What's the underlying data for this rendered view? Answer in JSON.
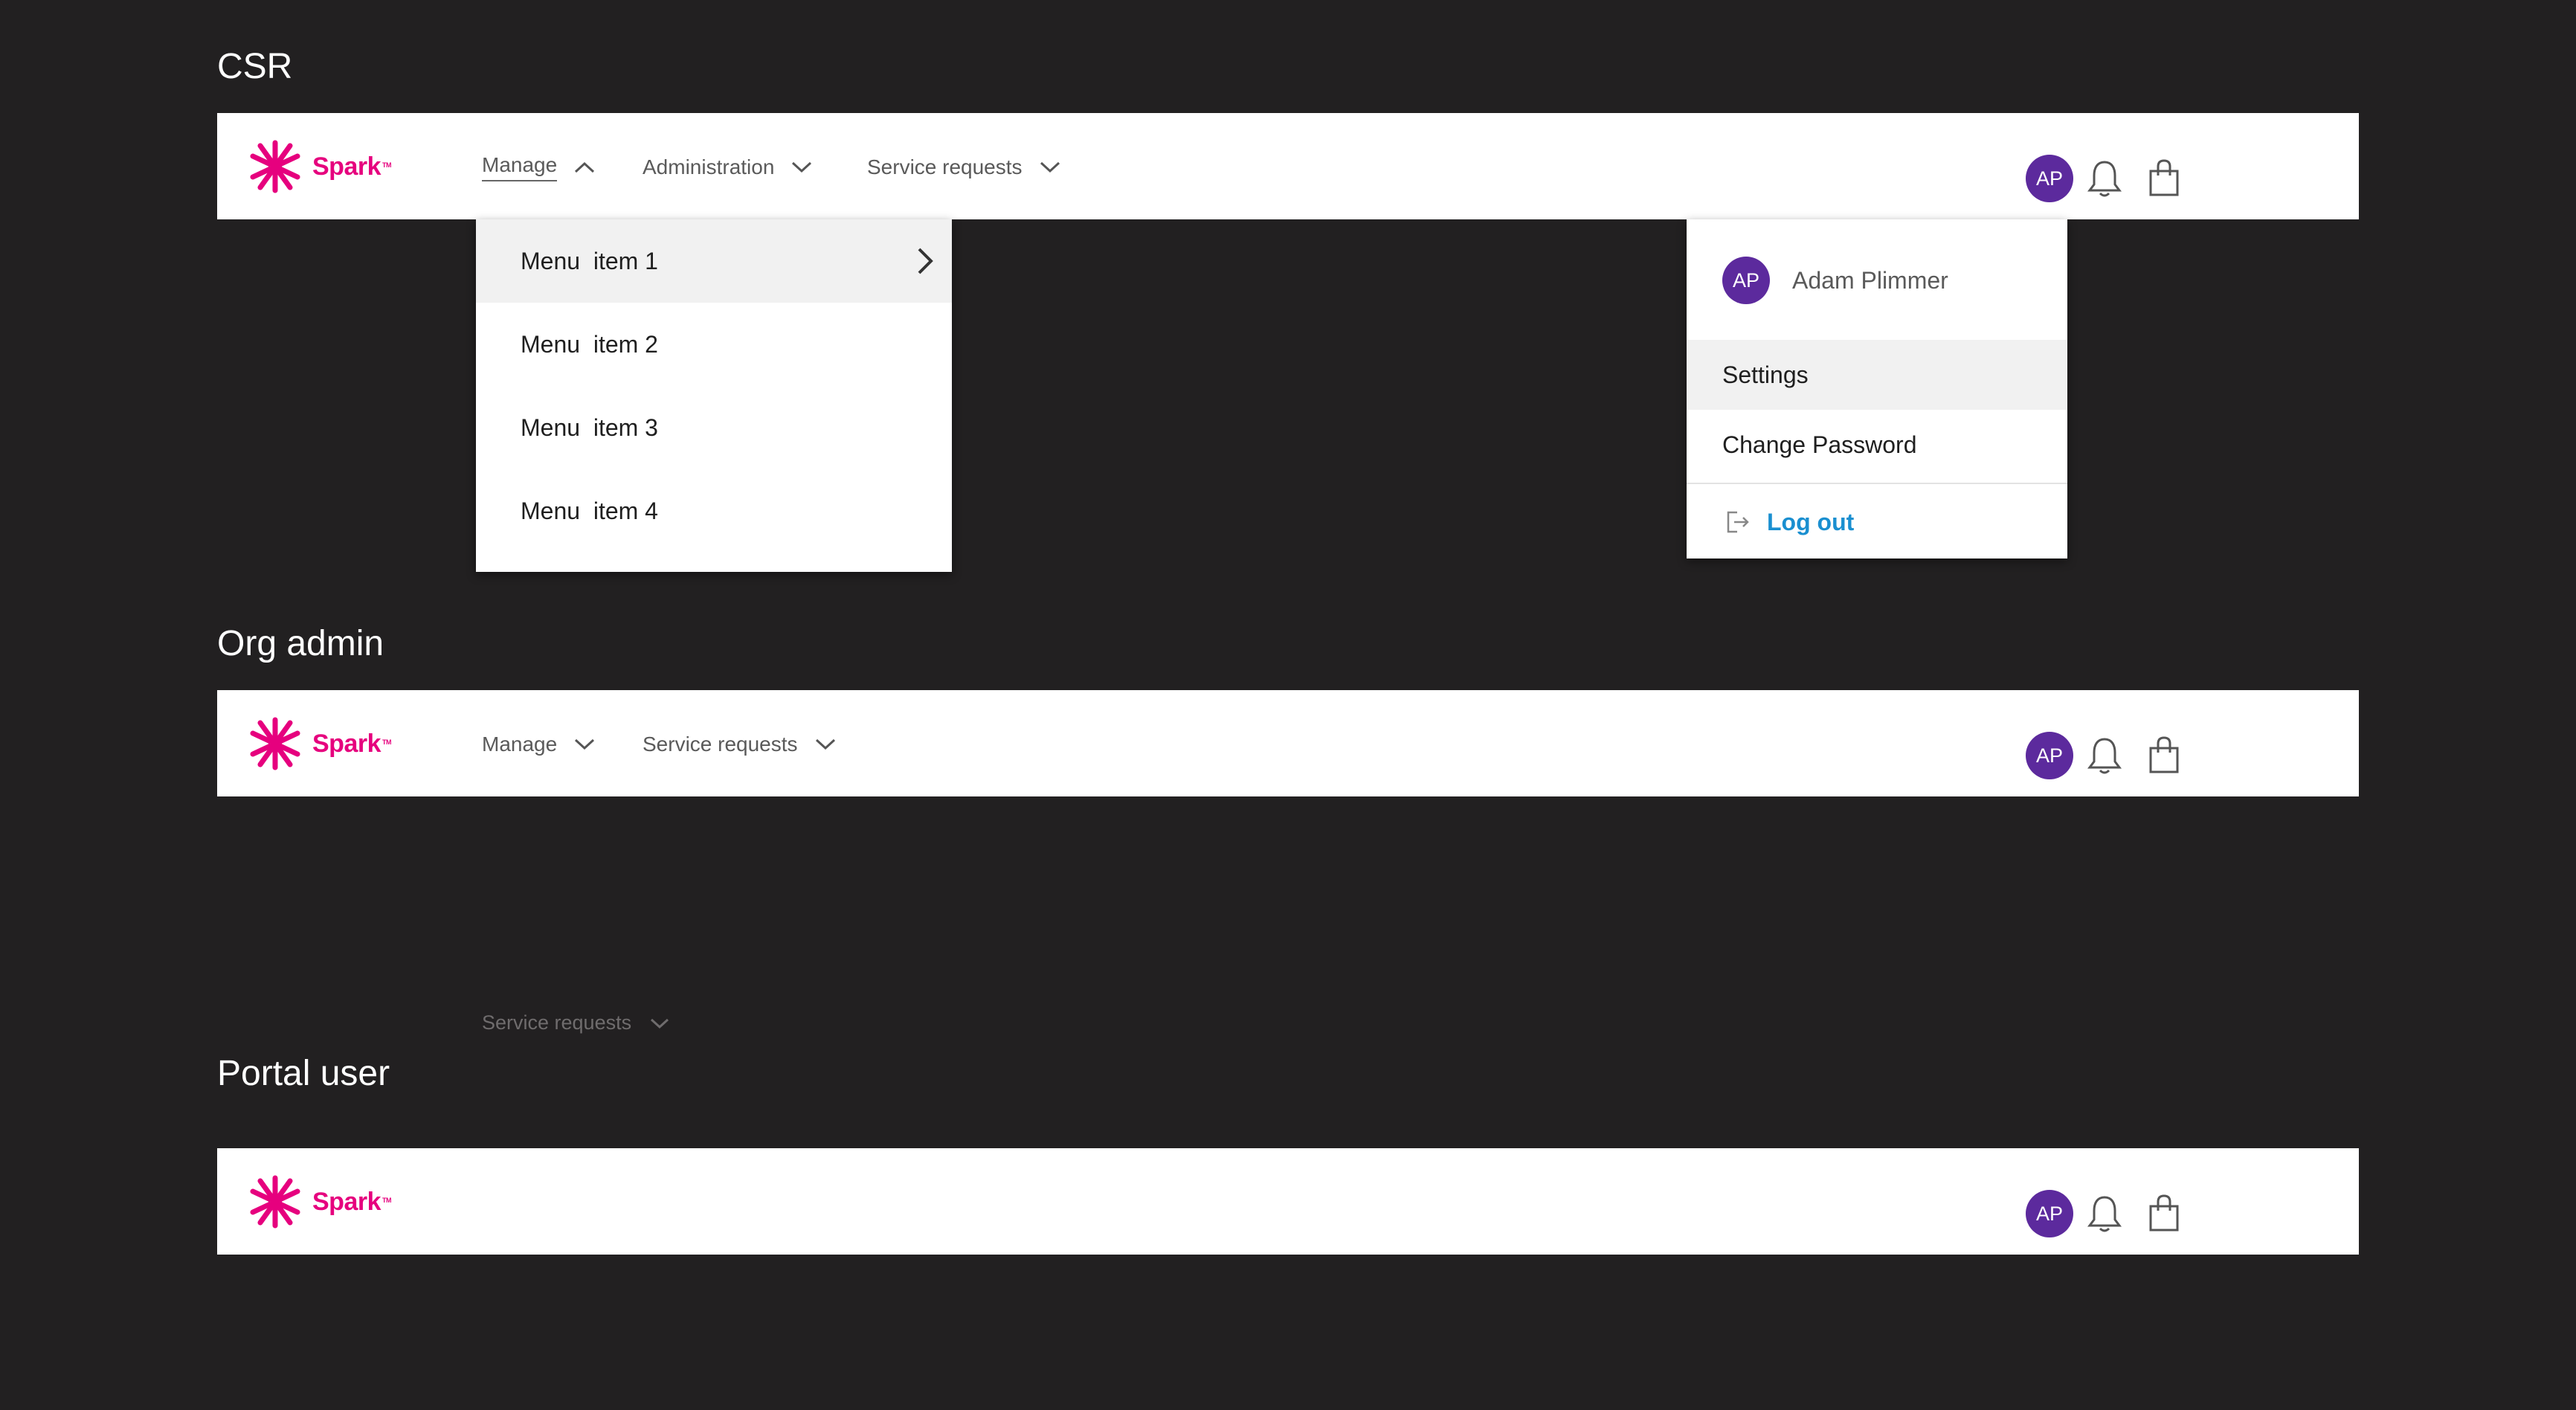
{
  "brand": {
    "name": "Spark",
    "tm": "TM",
    "color": "#e6007e"
  },
  "accent_color": "#5c2a9d",
  "link_color": "#1a8fd0",
  "sections": {
    "csr": {
      "title": "CSR",
      "nav": [
        {
          "label": "Manage",
          "icon": "chevron-up-icon",
          "active": true
        },
        {
          "label": "Administration",
          "icon": "chevron-down-icon"
        },
        {
          "label": "Service requests",
          "icon": "chevron-down-icon"
        }
      ],
      "manage_menu": [
        {
          "label": "Menu  item 1",
          "has_submenu": true,
          "icon": "chevron-right-icon"
        },
        {
          "label": "Menu  item 2"
        },
        {
          "label": "Menu  item 3"
        },
        {
          "label": "Menu  item 4"
        }
      ],
      "user_menu": {
        "initials": "AP",
        "name": "Adam Plimmer",
        "items": [
          "Settings",
          "Change Password"
        ],
        "logout": {
          "label": "Log out",
          "icon": "logout-icon"
        }
      }
    },
    "org_admin": {
      "title": "Org admin",
      "nav": [
        {
          "label": "Manage",
          "icon": "chevron-down-icon"
        },
        {
          "label": "Service requests",
          "icon": "chevron-down-icon"
        }
      ]
    },
    "portal_user": {
      "title": "Portal user"
    }
  },
  "floating_nav_item": {
    "label": "Service requests",
    "icon": "chevron-down-icon"
  },
  "header_icons": {
    "avatar_initials": "AP",
    "bell": "bell-icon",
    "bag": "shopping-bag-icon"
  }
}
